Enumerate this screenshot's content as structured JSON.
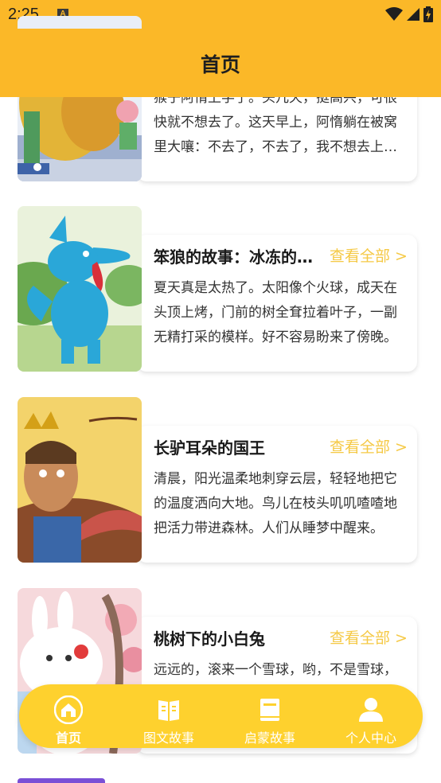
{
  "status_bar": {
    "time": "2:25",
    "notification_icon": "a-icon",
    "wifi_icon": "wifi-icon",
    "signal_icon": "signal-icon",
    "battery_icon": "battery-charging-icon"
  },
  "header": {
    "title": "首页"
  },
  "stories": [
    {
      "title": "",
      "view_all": "",
      "description": "猴子阿惰上学了。头几天，挺高兴，可很快就不想去了。这天早上，阿惰躺在被窝里大嚷：不去了，不去了，我不想去上学了。"
    },
    {
      "title": "笨狼的故事：冰冻的棒冰",
      "view_all": "查看全部 >",
      "description": "夏天真是太热了。太阳像个火球，成天在头顶上烤，门前的树全耷拉着叶子，一副无精打采的模样。好不容易盼来了傍晚。"
    },
    {
      "title": "长驴耳朵的国王",
      "view_all": "查看全部 >",
      "description": "清晨，阳光温柔地刺穿云层，轻轻地把它的温度洒向大地。鸟儿在枝头叽叽喳喳地把活力带进森林。人们从睡梦中醒来。"
    },
    {
      "title": "桃树下的小白兔",
      "view_all": "查看全部 >",
      "description": "远远的，滚来一个雪球，哟，不是雪球，是一只小白兔，它蹦蹦跳跳地来到桃树下。"
    }
  ],
  "tabs": [
    {
      "label": "首页",
      "icon": "home-icon",
      "active": true
    },
    {
      "label": "图文故事",
      "icon": "book-icon",
      "active": false
    },
    {
      "label": "启蒙故事",
      "icon": "notebook-icon",
      "active": false
    },
    {
      "label": "个人中心",
      "icon": "person-icon",
      "active": false
    }
  ],
  "colors": {
    "accent": "#FBB828",
    "tab_bar": "#FED12E",
    "link": "#F5C945"
  }
}
